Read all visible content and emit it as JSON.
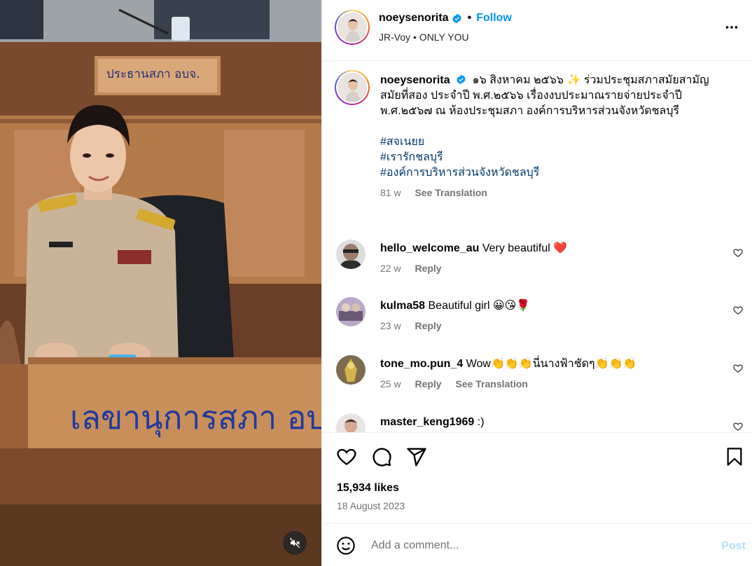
{
  "post": {
    "username": "noeysenorita",
    "follow_label": "Follow",
    "audio": "JR-Voy • ONLY YOU",
    "more_icon": "more-horizontal-icon"
  },
  "media": {
    "desk_sign_top": "ประธานสภา อบจ.",
    "desk_sign_front": "เลขานุการสภา อบจ"
  },
  "caption": {
    "username": "noeysenorita",
    "text": "๑๖ สิงหาคม ๒๕๖๖ ✨ ร่วมประชุมสภาสมัยสามัญ สมัยที่สอง ประจำปี พ.ศ.๒๕๖๖ เรื่องงบประมาณรายจ่ายประจำปี พ.ศ.๒๕๖๗ ณ ห้องประชุมสภา องค์การบริหารส่วนจังหวัดชลบุรี",
    "hashtags": [
      "#สจเนยย",
      "#เรารักชลบุรี",
      "#องค์การบริหารส่วนจังหวัดชลบุรี"
    ],
    "time": "81 w",
    "see_translation": "See Translation"
  },
  "comments": [
    {
      "username": "hello_welcome_au",
      "text": "Very beautiful ❤️",
      "time": "22 w",
      "reply": "Reply"
    },
    {
      "username": "kulma58",
      "text": "Beautiful girl 😀😘🌹",
      "time": "23 w",
      "reply": "Reply"
    },
    {
      "username": "tone_mo.pun_4",
      "text": "Wow👏👏👏นี่นางฟ้าชัดๆ👏👏👏",
      "time": "25 w",
      "reply": "Reply",
      "see_translation": "See Translation"
    },
    {
      "username": "master_keng1969",
      "text": ":)"
    }
  ],
  "stats": {
    "likes": "15,934 likes",
    "date": "18 August 2023"
  },
  "add_comment": {
    "placeholder": "Add a comment...",
    "post_label": "Post"
  },
  "colors": {
    "link_blue": "#0095f6",
    "hashtag_blue": "#00376b",
    "secondary_text": "#737373",
    "post_disabled": "#b2dffc"
  }
}
